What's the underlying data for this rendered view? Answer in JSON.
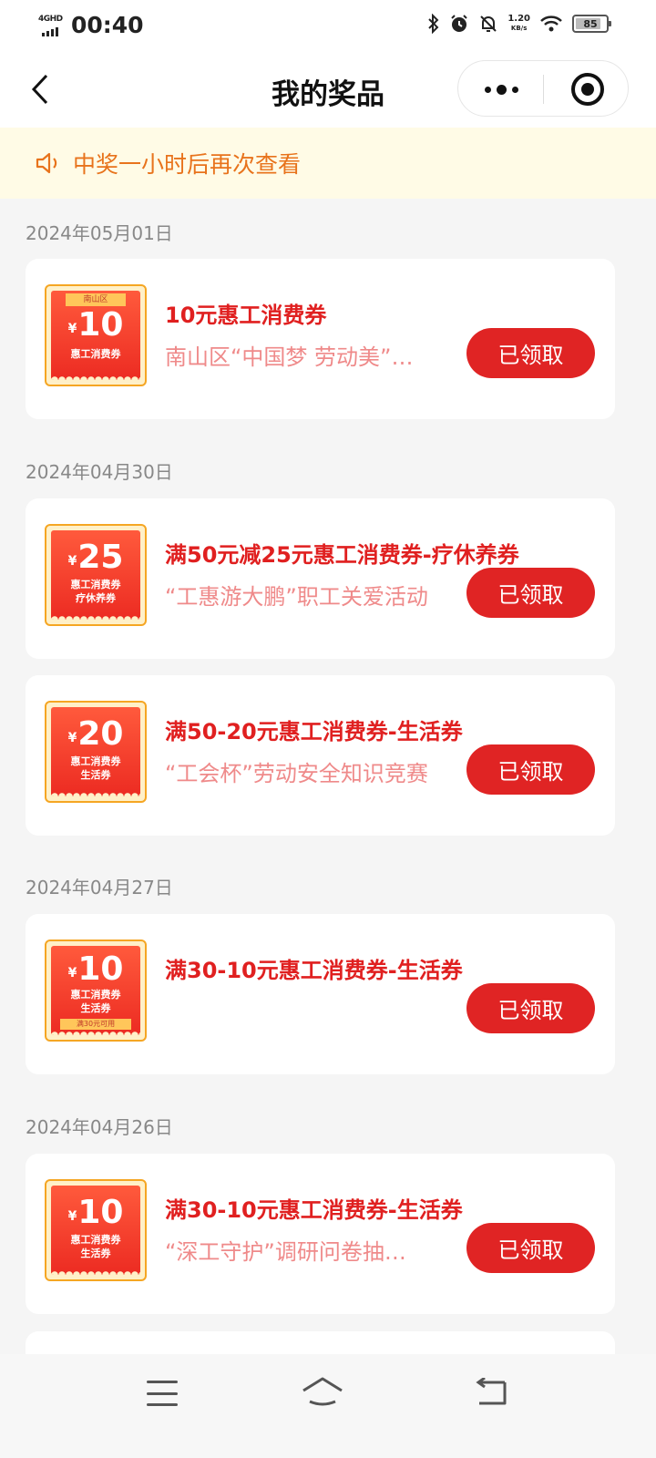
{
  "status_bar": {
    "network_label": "4GHD",
    "time": "00:40",
    "speed_value": "1.20",
    "speed_unit": "KB/s",
    "battery": "85",
    "icons": [
      "bluetooth-icon",
      "alarm-icon",
      "mute-bell-icon",
      "wifi-icon"
    ]
  },
  "nav": {
    "title": "我的奖品",
    "back_icon": "chevron-left-icon",
    "more_icon": "more-dots-icon",
    "close_icon": "target-close-icon"
  },
  "notice": {
    "icon": "speaker-icon",
    "text": "中奖一小时后再次查看",
    "color": "#e8731c"
  },
  "dates": [
    "2024年05月01日",
    "2024年04月30日",
    "2024年04月27日",
    "2024年04月26日"
  ],
  "prizes": [
    {
      "coupon": {
        "region": "南山区",
        "currency": "¥",
        "amount": "10",
        "line1": "惠工消费券",
        "line2": "",
        "condition": ""
      },
      "title": "10元惠工消费券",
      "desc": "南山区“中国梦 劳动美”…",
      "button": "已领取"
    },
    {
      "coupon": {
        "region": "",
        "currency": "¥",
        "amount": "25",
        "line1": "惠工消费券",
        "line2": "疗休养券",
        "condition": ""
      },
      "title": "满50元减25元惠工消费券-疗休养券",
      "desc": "“工惠游大鹏”职工关爱活动",
      "button": "已领取"
    },
    {
      "coupon": {
        "region": "",
        "currency": "¥",
        "amount": "20",
        "line1": "惠工消费券",
        "line2": "生活券",
        "condition": ""
      },
      "title": "满50-20元惠工消费券-生活券",
      "desc": "“工会杯”劳动安全知识竞赛",
      "button": "已领取"
    },
    {
      "coupon": {
        "region": "",
        "currency": "¥",
        "amount": "10",
        "line1": "惠工消费券",
        "line2": "生活券",
        "condition": "满30元可用"
      },
      "title": "满30-10元惠工消费券-生活券",
      "desc": "",
      "button": "已领取"
    },
    {
      "coupon": {
        "region": "",
        "currency": "¥",
        "amount": "10",
        "line1": "惠工消费券",
        "line2": "生活券",
        "condition": ""
      },
      "title": "满30-10元惠工消费券-生活券",
      "desc": "“深工守护”调研问卷抽…",
      "button": "已领取"
    }
  ],
  "colors": {
    "accent_red": "#e02424",
    "title_red": "#e02020",
    "desc_pink": "#ef8a8a",
    "notice_bg": "#fffbe6",
    "coupon_border": "#f5a623"
  },
  "system_nav": {
    "icons": [
      "menu-icon",
      "home-icon",
      "back-icon"
    ]
  }
}
